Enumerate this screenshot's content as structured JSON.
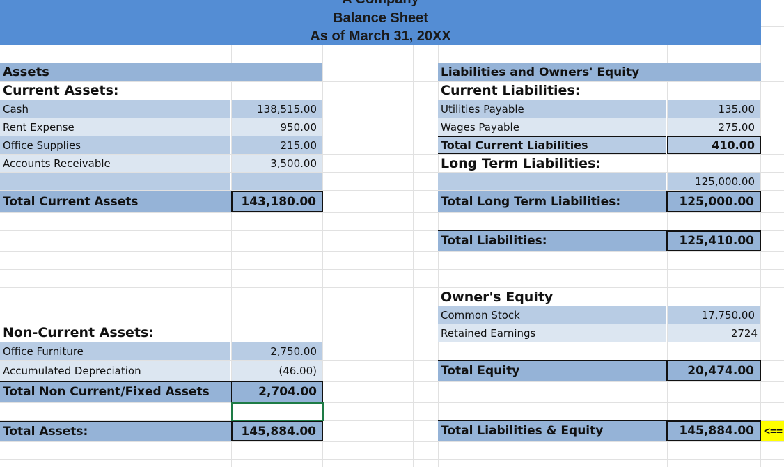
{
  "header": {
    "company": "A Company",
    "title": "Balance Sheet",
    "date": "As of March 31, 20XX"
  },
  "assets": {
    "heading": "Assets",
    "current_heading": "Current Assets:",
    "current_items": [
      {
        "label": "Cash",
        "value": "138,515.00"
      },
      {
        "label": "Rent Expense",
        "value": "950.00"
      },
      {
        "label": "Office Supplies",
        "value": "215.00"
      },
      {
        "label": "Accounts Receivable",
        "value": "3,500.00"
      }
    ],
    "total_current_label": "Total Current Assets",
    "total_current_value": "143,180.00",
    "noncurrent_heading": "Non-Current Assets:",
    "noncurrent_items": [
      {
        "label": "Office Furniture",
        "value": "2,750.00"
      },
      {
        "label": "Accumulated Depreciation",
        "value": "(46.00)"
      }
    ],
    "total_noncurrent_label": "Total Non Current/Fixed Assets",
    "total_noncurrent_value": "2,704.00",
    "total_label": "Total Assets:",
    "total_value": "145,884.00"
  },
  "liabilities": {
    "heading": "Liabilities and Owners' Equity",
    "current_heading": "Current Liabilities:",
    "current_items": [
      {
        "label": "Utilities Payable",
        "value": "135.00"
      },
      {
        "label": "Wages Payable",
        "value": "275.00"
      }
    ],
    "total_current_label": "Total Current Liabilities",
    "total_current_value": "410.00",
    "longterm_heading": "Long Term Liabilities:",
    "longterm_value": "125,000.00",
    "total_longterm_label": "Total Long Term Liabilities:",
    "total_longterm_value": "125,000.00",
    "total_label": "Total Liabilities:",
    "total_value": "125,410.00"
  },
  "equity": {
    "heading": "Owner's Equity",
    "items": [
      {
        "label": "Common Stock",
        "value": "17,750.00"
      },
      {
        "label": "Retained Earnings",
        "value": "2724"
      }
    ],
    "total_label": "Total Equity",
    "total_value": "20,474.00"
  },
  "grand_total": {
    "label": "Total Liabilities & Equity",
    "value": "145,884.00",
    "flag": "<=="
  },
  "colors": {
    "banner": "#548dd4",
    "band_dark": "#95b3d7",
    "band_light": "#b8cce4",
    "band_extra_light": "#dce6f1",
    "selection": "#1e7b45",
    "flag": "#ffff00"
  }
}
